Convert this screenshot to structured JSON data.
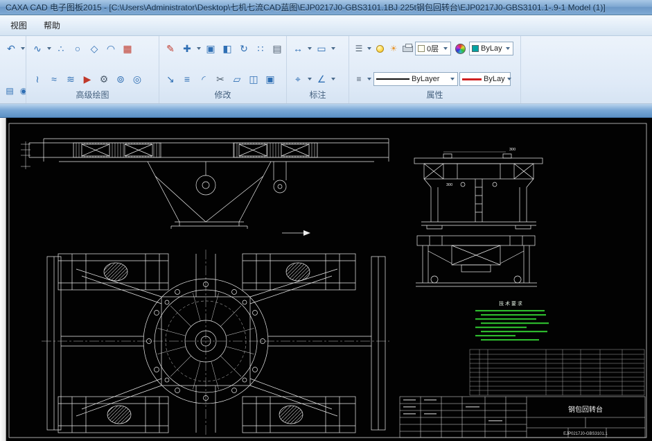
{
  "window": {
    "title": "CAXA CAD 电子图板2015 - [C:\\Users\\Administrator\\Desktop\\七机七流CAD蓝图\\EJP0217J0-GBS3101.1BJ 225t钢包回转台\\EJP0217J0-GBS3101.1-.9-1 Model (1)]"
  },
  "menu": {
    "view": "视图",
    "help": "帮助"
  },
  "ribbon": {
    "groups": {
      "advanced": "高级绘图",
      "modify": "修改",
      "dimension": "标注",
      "properties": "属性"
    },
    "quick1": [
      {
        "glyph": "↶"
      }
    ],
    "quick2": [
      {
        "glyph": "▤"
      },
      {
        "glyph": "◉"
      }
    ],
    "adv1": [
      {
        "glyph": "∿"
      },
      {
        "glyph": "∴"
      },
      {
        "glyph": "○"
      },
      {
        "glyph": "◇"
      },
      {
        "glyph": "◠"
      },
      {
        "glyph": "▦"
      }
    ],
    "adv2": [
      {
        "glyph": "≀"
      },
      {
        "glyph": "≈"
      },
      {
        "glyph": "≋"
      },
      {
        "glyph": "▶"
      },
      {
        "glyph": "⚙"
      },
      {
        "glyph": "⊚"
      },
      {
        "glyph": "◎"
      }
    ],
    "mod1": [
      {
        "glyph": "✎"
      },
      {
        "glyph": "✚"
      },
      {
        "glyph": "▣"
      },
      {
        "glyph": "◧"
      },
      {
        "glyph": "↻"
      },
      {
        "glyph": "∷"
      },
      {
        "glyph": "▤"
      }
    ],
    "mod2": [
      {
        "glyph": "↘"
      },
      {
        "glyph": "≡"
      },
      {
        "glyph": "◜"
      },
      {
        "glyph": "✂"
      },
      {
        "glyph": "▱"
      },
      {
        "glyph": "◫"
      },
      {
        "glyph": "▣"
      }
    ],
    "dim1": [
      {
        "glyph": "↔"
      },
      {
        "glyph": "▭"
      }
    ],
    "dim2": [
      {
        "glyph": "⌖"
      },
      {
        "glyph": "∠"
      }
    ],
    "prop": {
      "layer_tool_glyph": "☰",
      "sun_glyph": "☀",
      "layer_combo": "0层",
      "color_combo": "ByLay",
      "linetype_tool_glyph": "≡",
      "linetype_combo": "ByLayer",
      "linewidth_combo": "ByLay"
    }
  },
  "canvas": {
    "notes_title": "技 术 要 求",
    "part_name": "钢包回转台",
    "drawing_number": "EJP0217J0-GBS3101.1",
    "dim_a": "300",
    "dim_b": "300"
  }
}
